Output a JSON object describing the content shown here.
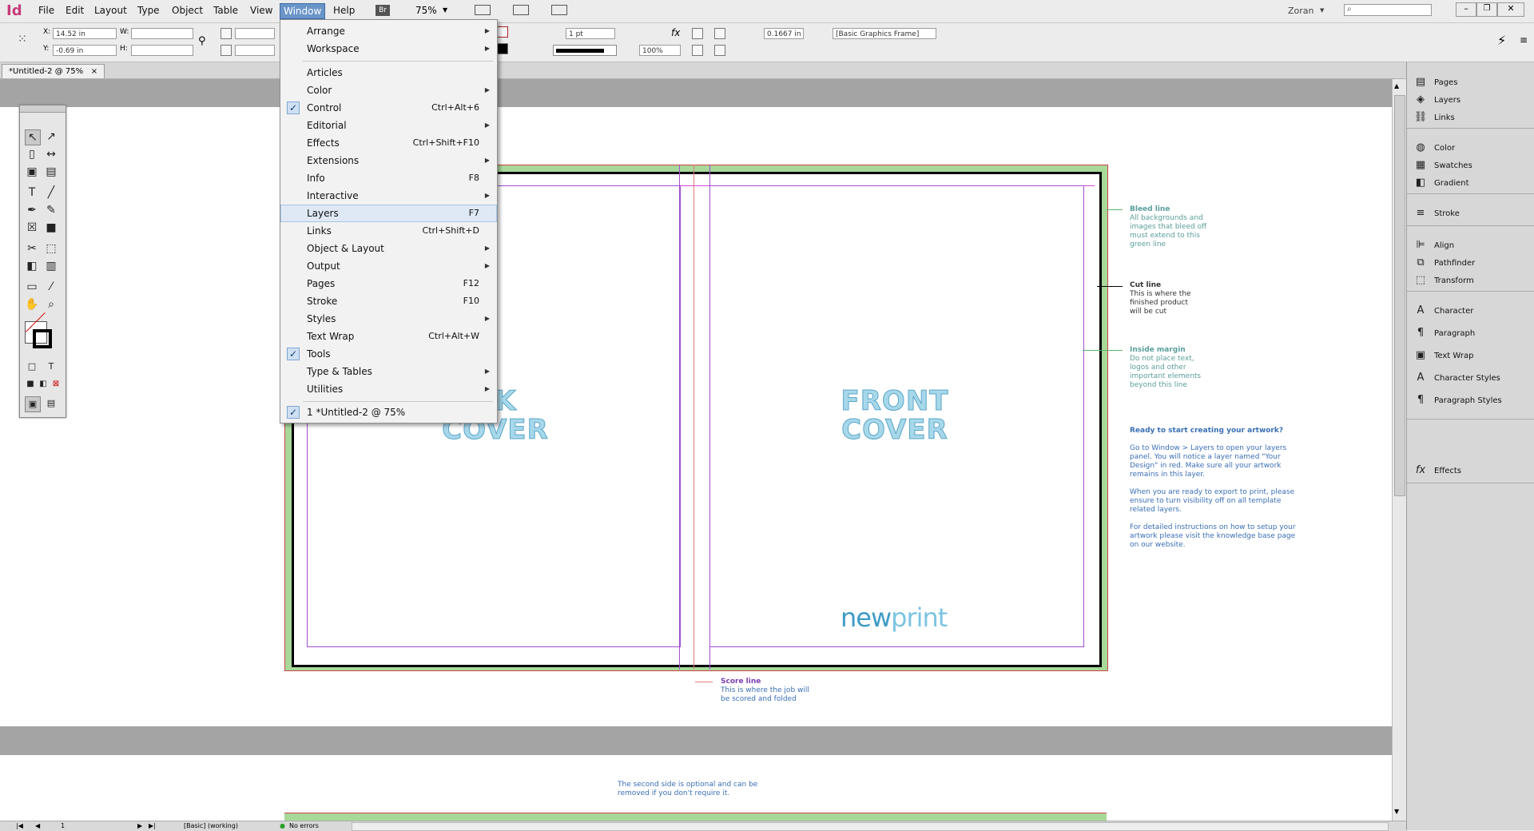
{
  "app": {
    "logo": "Id",
    "user": "Zoran",
    "zoom": "75%"
  },
  "menubar": [
    "File",
    "Edit",
    "Layout",
    "Type",
    "Object",
    "Table",
    "View",
    "Window",
    "Help"
  ],
  "menubar_active": "Window",
  "bridge_label": "Br",
  "search_placeholder": "",
  "control": {
    "x_label": "X:",
    "x_value": "14.52 in",
    "y_label": "Y:",
    "y_value": "-0.69 in",
    "w_label": "W:",
    "h_label": "H:",
    "stroke_weight": "1 pt",
    "opacity": "100%",
    "fitting_value": "0.1667 in",
    "object_style": "[Basic Graphics Frame]"
  },
  "tab": {
    "label": "*Untitled-2 @ 75%",
    "close": "×"
  },
  "window_menu": [
    {
      "label": "Arrange",
      "shortcut": "",
      "submenu": true,
      "checked": false
    },
    {
      "label": "Workspace",
      "shortcut": "",
      "submenu": true,
      "checked": false
    },
    {
      "label": "Articles",
      "shortcut": "",
      "submenu": false,
      "checked": false
    },
    {
      "label": "Color",
      "shortcut": "",
      "submenu": true,
      "checked": false
    },
    {
      "label": "Control",
      "shortcut": "Ctrl+Alt+6",
      "submenu": false,
      "checked": true
    },
    {
      "label": "Editorial",
      "shortcut": "",
      "submenu": true,
      "checked": false
    },
    {
      "label": "Effects",
      "shortcut": "Ctrl+Shift+F10",
      "submenu": false,
      "checked": false
    },
    {
      "label": "Extensions",
      "shortcut": "",
      "submenu": true,
      "checked": false
    },
    {
      "label": "Info",
      "shortcut": "F8",
      "submenu": false,
      "checked": false
    },
    {
      "label": "Interactive",
      "shortcut": "",
      "submenu": true,
      "checked": false
    },
    {
      "label": "Layers",
      "shortcut": "F7",
      "submenu": false,
      "checked": false,
      "highlighted": true
    },
    {
      "label": "Links",
      "shortcut": "Ctrl+Shift+D",
      "submenu": false,
      "checked": false
    },
    {
      "label": "Object & Layout",
      "shortcut": "",
      "submenu": true,
      "checked": false
    },
    {
      "label": "Output",
      "shortcut": "",
      "submenu": true,
      "checked": false
    },
    {
      "label": "Pages",
      "shortcut": "F12",
      "submenu": false,
      "checked": false
    },
    {
      "label": "Stroke",
      "shortcut": "F10",
      "submenu": false,
      "checked": false
    },
    {
      "label": "Styles",
      "shortcut": "",
      "submenu": true,
      "checked": false
    },
    {
      "label": "Text Wrap",
      "shortcut": "Ctrl+Alt+W",
      "submenu": false,
      "checked": false
    },
    {
      "label": "Tools",
      "shortcut": "",
      "submenu": false,
      "checked": true
    },
    {
      "label": "Type & Tables",
      "shortcut": "",
      "submenu": true,
      "checked": false
    },
    {
      "label": "Utilities",
      "shortcut": "",
      "submenu": true,
      "checked": false
    },
    {
      "label": "1 *Untitled-2 @ 75%",
      "shortcut": "",
      "submenu": false,
      "checked": true
    }
  ],
  "panels": [
    {
      "label": "Pages",
      "icon": "pages-icon",
      "glyph": "▤"
    },
    {
      "label": "Layers",
      "icon": "layers-icon",
      "glyph": "◈"
    },
    {
      "label": "Links",
      "icon": "links-icon",
      "glyph": "⛓"
    },
    {
      "label": "Color",
      "icon": "color-icon",
      "glyph": "◍"
    },
    {
      "label": "Swatches",
      "icon": "swatches-icon",
      "glyph": "▦"
    },
    {
      "label": "Gradient",
      "icon": "gradient-icon",
      "glyph": "◧"
    },
    {
      "label": "Stroke",
      "icon": "stroke-icon",
      "glyph": "≡"
    },
    {
      "label": "Align",
      "icon": "align-icon",
      "glyph": "⊫"
    },
    {
      "label": "Pathfinder",
      "icon": "pathfinder-icon",
      "glyph": "⧉"
    },
    {
      "label": "Transform",
      "icon": "transform-icon",
      "glyph": "⬚"
    },
    {
      "label": "Character",
      "icon": "character-icon",
      "glyph": "A"
    },
    {
      "label": "Paragraph",
      "icon": "paragraph-icon",
      "glyph": "¶"
    },
    {
      "label": "Text Wrap",
      "icon": "text-wrap-icon",
      "glyph": "▣"
    },
    {
      "label": "Character Styles",
      "icon": "character-styles-icon",
      "glyph": "A"
    },
    {
      "label": "Paragraph Styles",
      "icon": "paragraph-styles-icon",
      "glyph": "¶"
    },
    {
      "label": "Effects",
      "icon": "effects-icon",
      "glyph": "fx"
    }
  ],
  "artwork": {
    "back_cover_line1": "CK",
    "back_cover_line2": "COVER",
    "front_cover_line1": "FRONT",
    "front_cover_line2": "COVER",
    "brand_new": "new",
    "brand_print": "print",
    "bleed_title": "Bleed line",
    "bleed_text": "All backgrounds and images that bleed off must extend to this green line",
    "cut_title": "Cut line",
    "cut_text": "This is where the finished product will be cut",
    "margin_title": "Inside margin",
    "margin_text": "Do not place text, logos and other important elements beyond this line",
    "ready_title": "Ready to start creating your artwork?",
    "ready_p1": "Go to Window > Layers to open your layers panel. You will notice a layer named \"Your Design\" in red. Make sure all your artwork remains in this layer.",
    "ready_p2": "When you are ready to export to print, please ensure to turn visibility off on all template related layers.",
    "ready_p3": "For detailed instructions on how to setup your artwork please visit the knowledge base page on our website.",
    "score_title": "Score line",
    "score_text": "This is where the job will be scored and folded",
    "second_side": "The second side is optional and can be removed if you don't require it."
  },
  "status": {
    "page": "1",
    "master": "[Basic] (working)",
    "errors": "No errors"
  },
  "colors": {
    "bleed_green": "#a8d89a",
    "cut_black": "#000000",
    "margin_magenta": "#c23bd6",
    "menu_highlight": "#dfe9f6",
    "cover_text": "#a7d8ea",
    "note_blue": "#3a6fb6",
    "logo_pink": "#c83b7b"
  }
}
